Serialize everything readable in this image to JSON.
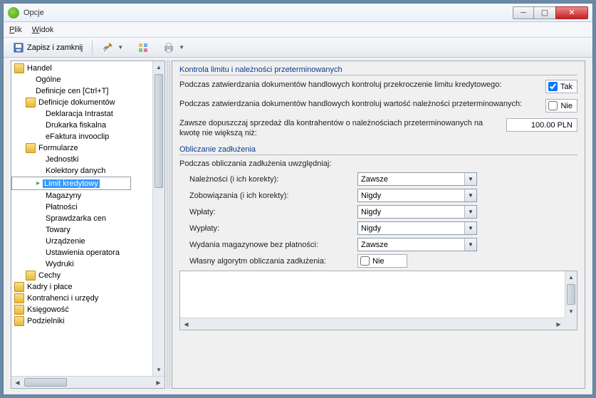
{
  "window": {
    "title": "Opcje"
  },
  "menu": {
    "file": "Plik",
    "view": "Widok"
  },
  "toolbar": {
    "save_close": "Zapisz i zamknij"
  },
  "tree": {
    "n0": "Handel",
    "n0_0": "Ogólne",
    "n0_1": "Definicje cen [Ctrl+T]",
    "n0_2": "Definicje dokumentów",
    "n0_2_0": "Deklaracja Intrastat",
    "n0_2_1": "Drukarka fiskalna",
    "n0_2_2": "eFaktura invooclip",
    "n0_3": "Formularze",
    "n0_3_0": "Jednostki",
    "n0_3_1": "Kolektory danych",
    "n0_3_2": "Limit kredytowy",
    "n0_3_3": "Magazyny",
    "n0_3_4": "Płatności",
    "n0_3_5": "Sprawdzarka cen",
    "n0_3_6": "Towary",
    "n0_3_7": "Urządzenie",
    "n0_3_8": "Ustawienia operatora",
    "n0_3_9": "Wydruki",
    "n0_4": "Cechy",
    "n1": "Kadry i płace",
    "n2": "Kontrahenci i urzędy",
    "n3": "Księgowość",
    "n4": "Podzielniki"
  },
  "grp1": {
    "title": "Kontrola limitu i należności przeterminowanych",
    "r1": "Podczas zatwierdzania dokumentów handlowych kontroluj przekroczenie limitu kredytowego:",
    "r1v": "Tak",
    "r2": "Podczas zatwierdzania dokumentów handlowych kontroluj wartość należności przeterminowanych:",
    "r2v": "Nie",
    "r3": "Zawsze dopuszczaj sprzedaż dla kontrahentów o należnościach przeterminowanych na kwotę nie większą niż:",
    "r3v": "100.00 PLN"
  },
  "grp2": {
    "title": "Obliczanie zadłużenia",
    "intro": "Podczas obliczania zadłużenia uwzględniaj:",
    "f1": "Należności (i ich korekty):",
    "f1v": "Zawsze",
    "f2": "Zobowiązania (i ich korekty):",
    "f2v": "Nigdy",
    "f3": "Wpłaty:",
    "f3v": "Nigdy",
    "f4": "Wypłaty:",
    "f4v": "Nigdy",
    "f5": "Wydania magazynowe bez płatności:",
    "f5v": "Zawsze",
    "f6": "Własny algorytm obliczania zadłużenia:",
    "f6v": "Nie"
  }
}
